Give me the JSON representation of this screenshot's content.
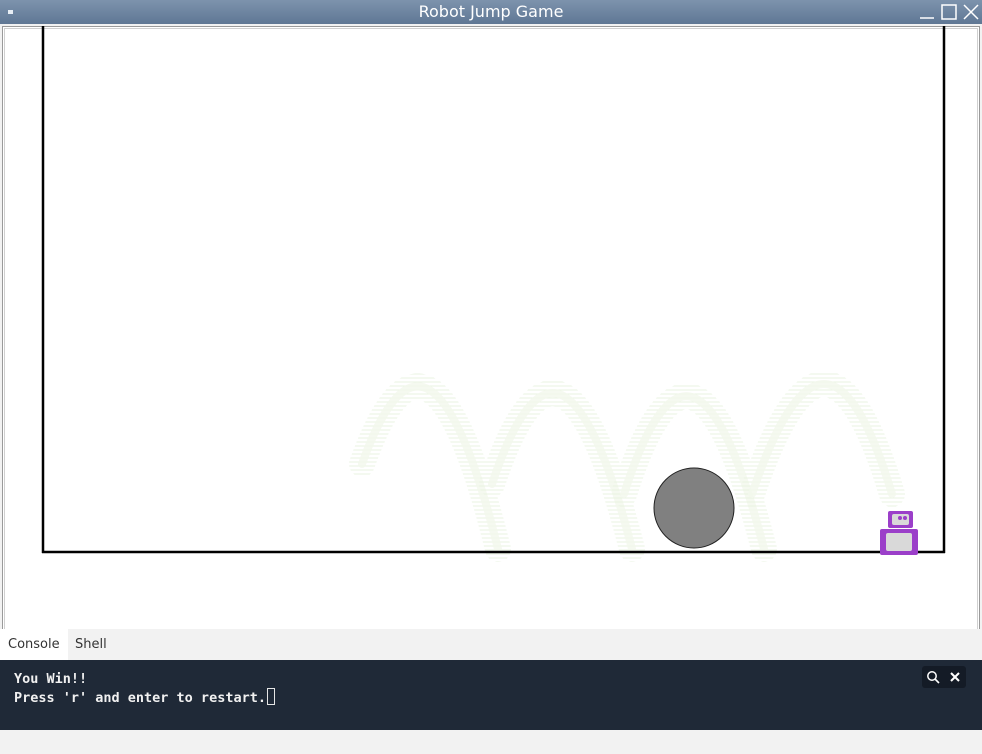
{
  "window": {
    "title": "Robot Jump Game"
  },
  "game": {
    "colors": {
      "arena_border": "#000000",
      "ball_fill": "#808080",
      "robot_body": "#9b3fc9",
      "robot_panel": "#d9d9d9",
      "trail": "#eef6e8"
    }
  },
  "tabs": [
    {
      "label": "Console",
      "active": true
    },
    {
      "label": "Shell",
      "active": false
    }
  ],
  "console": {
    "line1": "You Win!!",
    "line2": "Press 'r' and enter to restart.",
    "background": "#1f2937",
    "search_icon": "search-icon",
    "close_icon": "close-icon"
  }
}
